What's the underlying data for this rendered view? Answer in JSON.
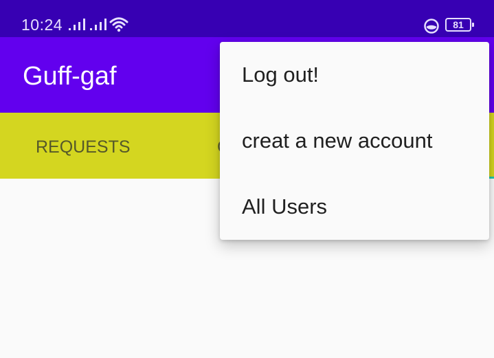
{
  "status_bar": {
    "time": "10:24",
    "battery_level": "81",
    "icons": [
      "signal-icon",
      "signal-icon",
      "wifi-icon",
      "status-circle-icon",
      "battery-icon"
    ]
  },
  "app_bar": {
    "title": "Guff-gaf"
  },
  "tabs": {
    "items": [
      {
        "label": "REQUESTS"
      },
      {
        "label": "C"
      }
    ]
  },
  "overflow_menu": {
    "items": [
      {
        "label": "Log out!"
      },
      {
        "label": "creat a new account"
      },
      {
        "label": "All Users"
      }
    ]
  },
  "colors": {
    "status_bar": "#3700b3",
    "app_bar": "#6200ee",
    "tab_bar": "#d4d620",
    "tab_indicator": "#1fc8b5",
    "menu_background": "#fafafa"
  }
}
